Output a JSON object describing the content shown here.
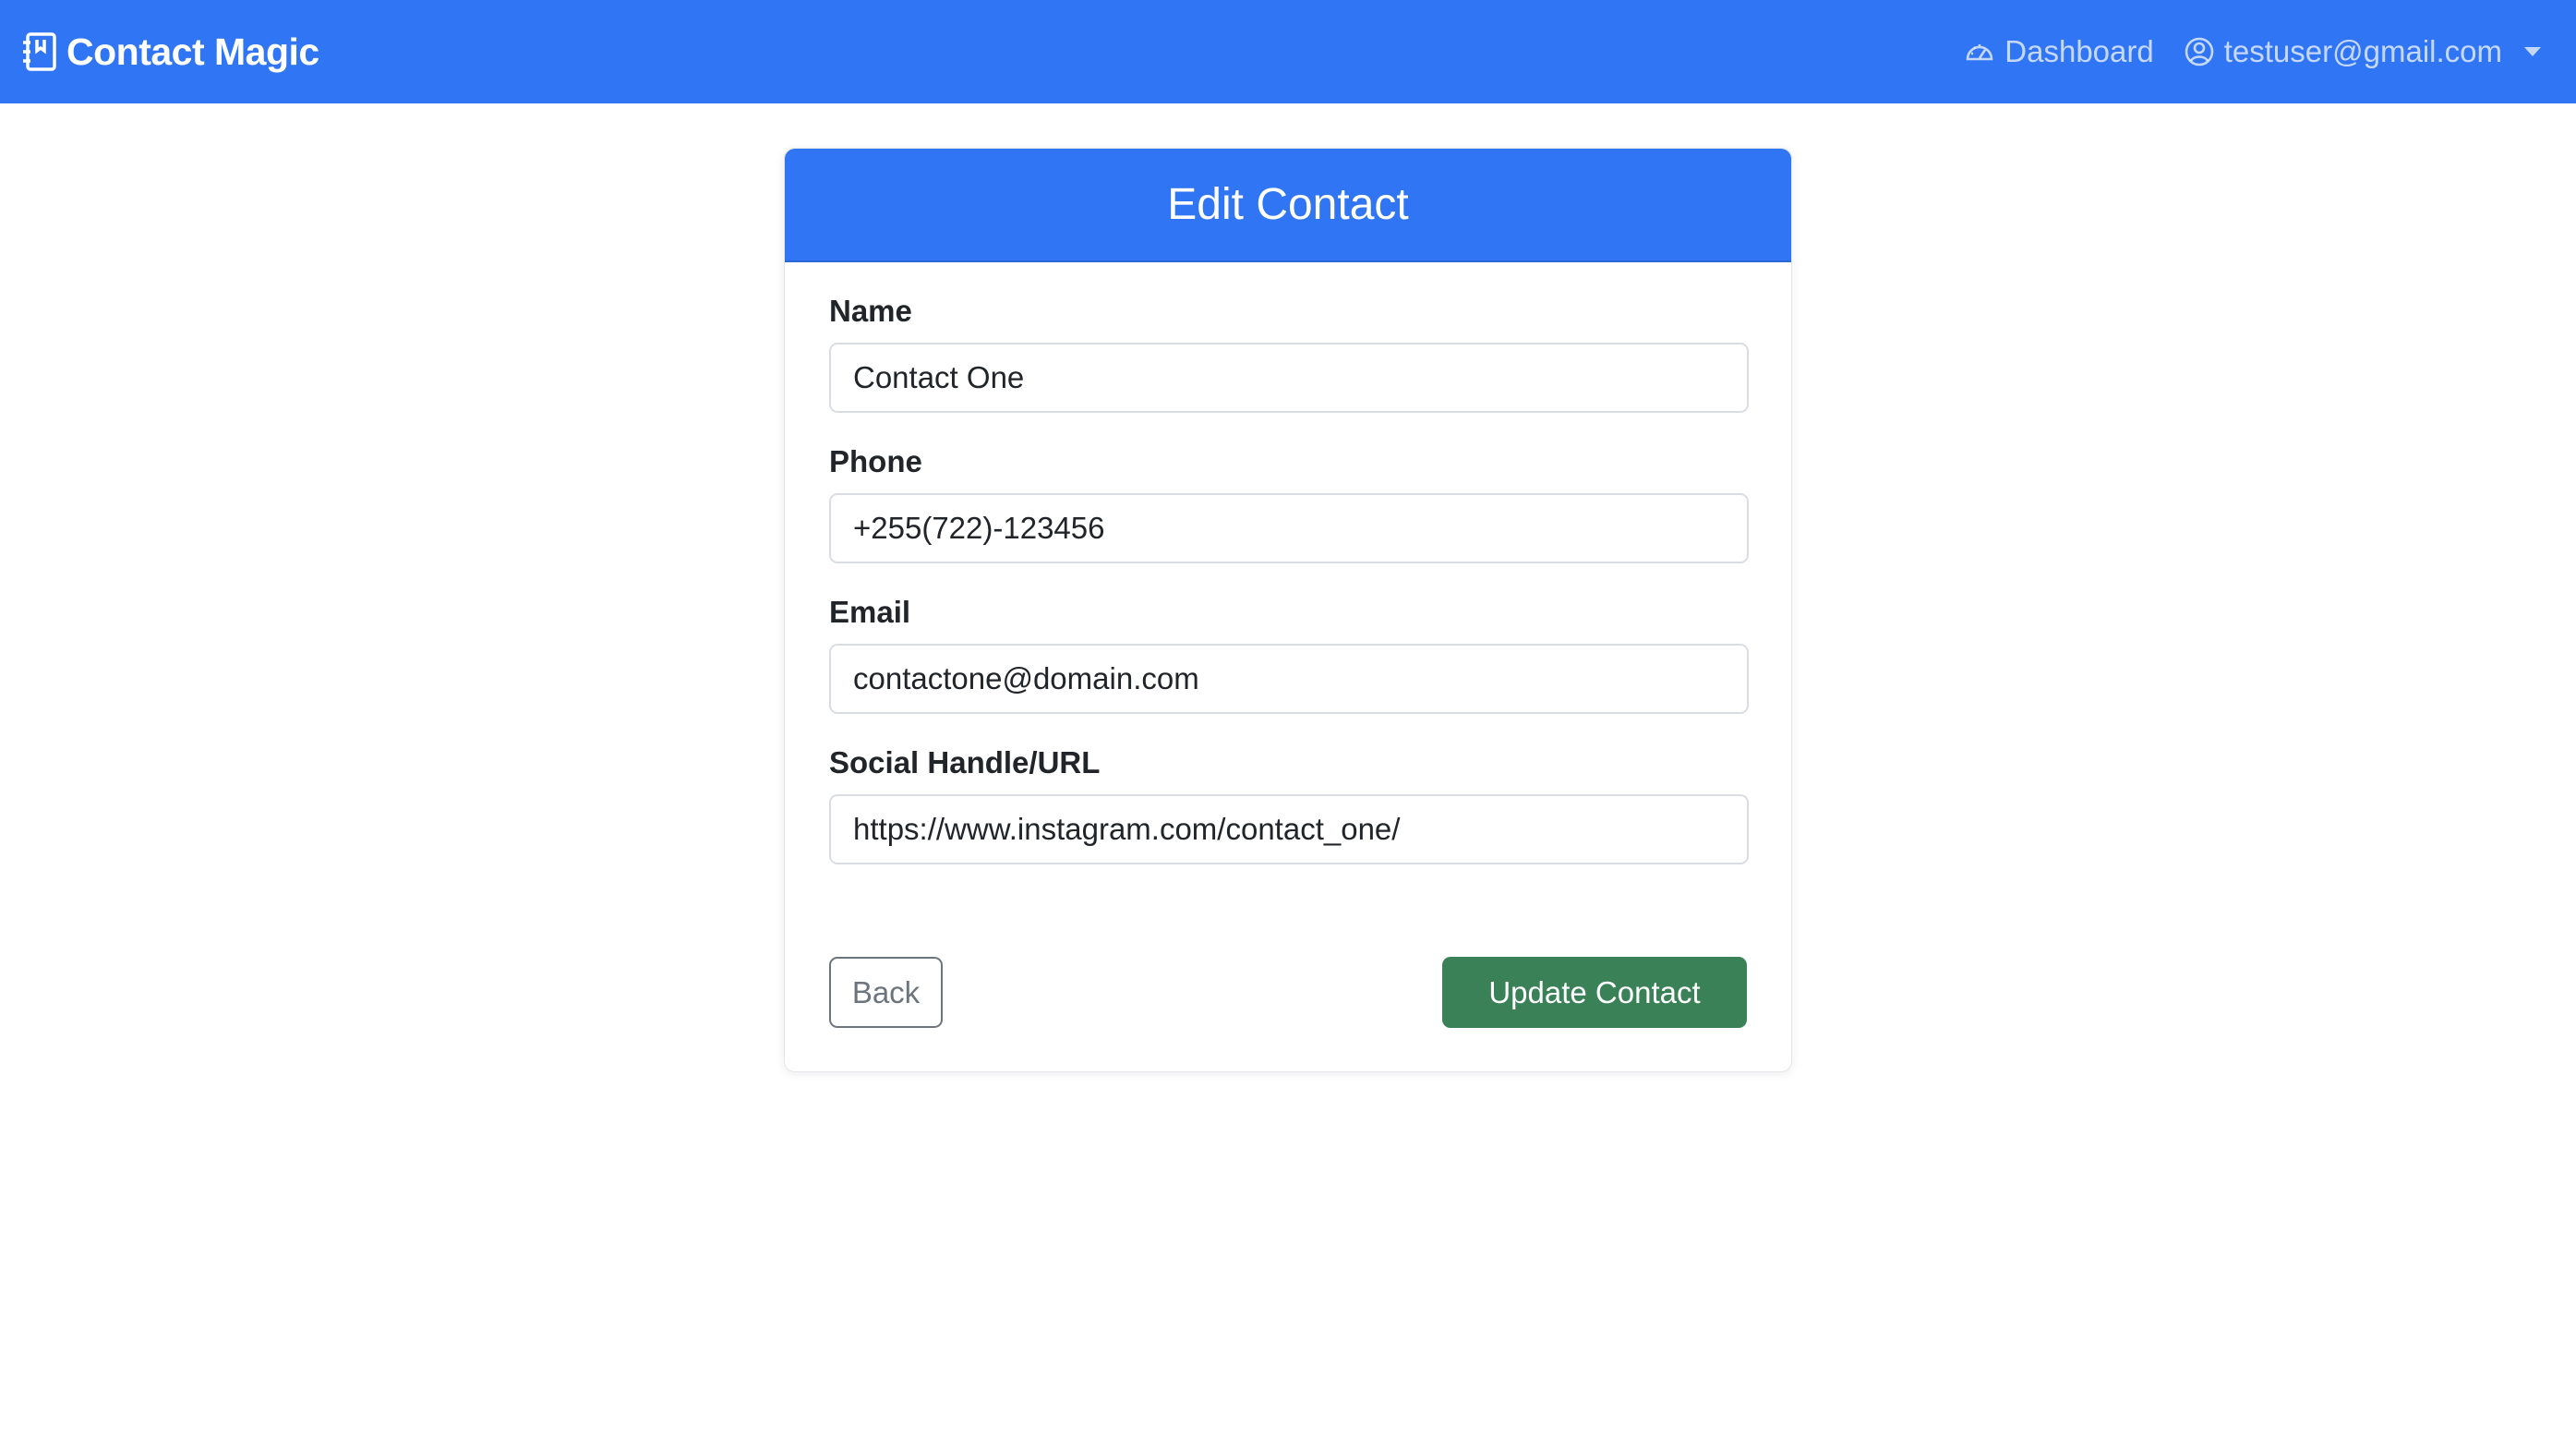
{
  "navbar": {
    "brand": "Contact Magic",
    "brand_icon": "address-book-icon",
    "dashboard_label": "Dashboard",
    "dashboard_icon": "speedometer-icon",
    "user_email": "testuser@gmail.com",
    "user_icon": "person-circle-icon",
    "accent_color": "#3075f3"
  },
  "form": {
    "title": "Edit Contact",
    "fields": [
      {
        "label": "Name",
        "value": "Contact One"
      },
      {
        "label": "Phone",
        "value": "+255(722)-123456"
      },
      {
        "label": "Email",
        "value": "contactone@domain.com"
      },
      {
        "label": "Social Handle/URL",
        "value": "https://www.instagram.com/contact_one/"
      }
    ],
    "back_label": "Back",
    "submit_label": "Update Contact",
    "submit_color": "#3a8157"
  }
}
